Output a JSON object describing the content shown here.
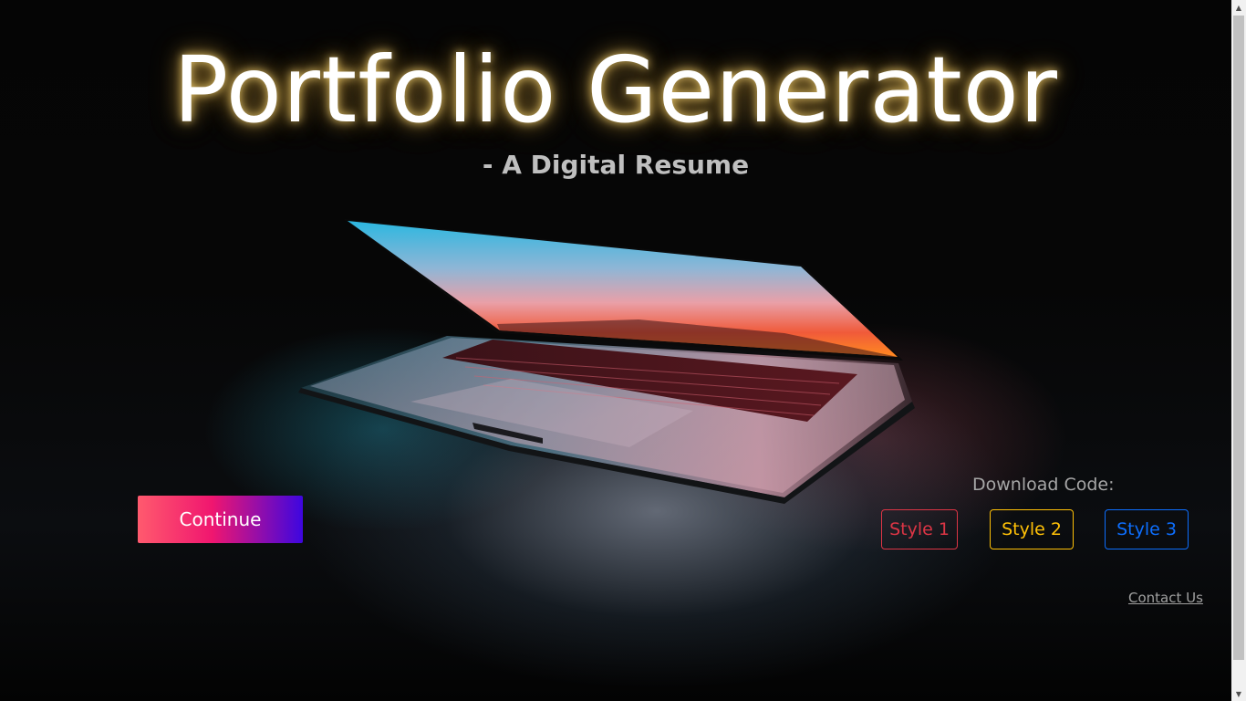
{
  "hero": {
    "title": "Portfolio Generator",
    "subtitle": "- A Digital Resume",
    "image": "laptop-glowing-screen",
    "title_glow_color": "#ffd070"
  },
  "actions": {
    "continue_label": "Continue",
    "continue_gradient": [
      "#ff5a6e",
      "#f0166f",
      "#3d06e0"
    ]
  },
  "download": {
    "label": "Download Code:",
    "styles": [
      {
        "label": "Style 1",
        "color": "#dc3545"
      },
      {
        "label": "Style 2",
        "color": "#ffc107"
      },
      {
        "label": "Style 3",
        "color": "#0d6efd"
      }
    ]
  },
  "footer": {
    "contact_label": "Contact Us"
  },
  "scrollbar": {
    "up_icon": "scroll-up-arrow",
    "down_icon": "scroll-down-arrow"
  }
}
